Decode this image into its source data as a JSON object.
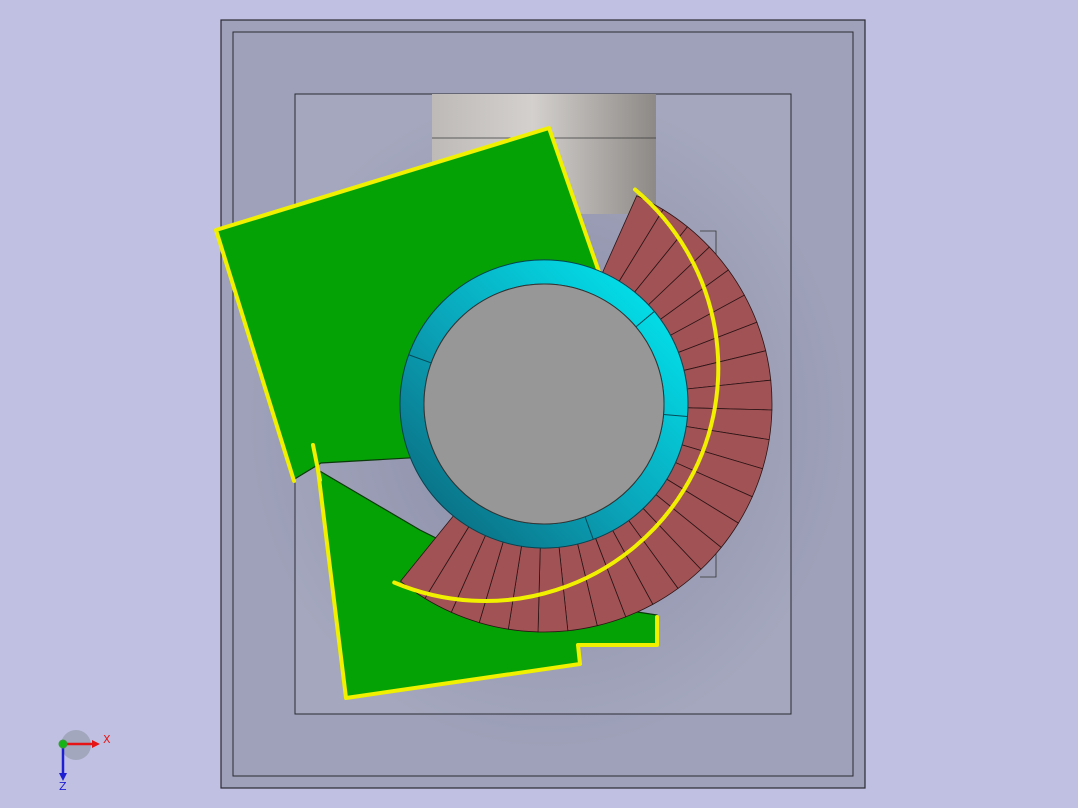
{
  "viewport": {
    "background_color": "#c0c0e2",
    "colors": {
      "outer_frame_fill": "#9ea1b9",
      "inner_frame_fill": "#a4a7bd",
      "frame_stroke": "#2a2a33",
      "cylinder_light": "#c9c6c3",
      "cylinder_dark": "#8f8b88",
      "platform_green": "#05a205",
      "stair_tread_red": "#a15255",
      "rail_yellow": "#f0f000",
      "rail_dark": "#6b6500",
      "ring_cyan": "#00e6ef",
      "ring_teal": "#0a6e80",
      "core_gray": "#979797"
    }
  },
  "triad": {
    "x_label": "X",
    "z_label": "Z",
    "x_color": "#e61414",
    "y_color": "#14b414",
    "z_color": "#1e1ed2",
    "origin_color": "#3a9a3a"
  }
}
